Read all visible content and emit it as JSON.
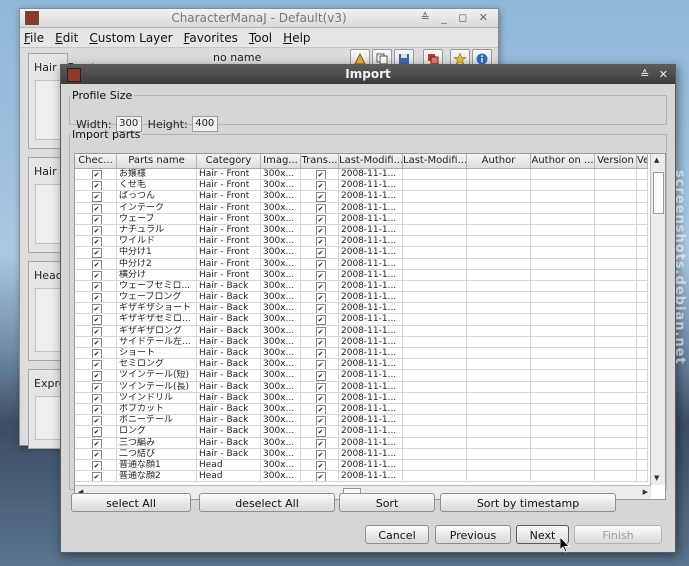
{
  "main_window": {
    "title": "CharacterManaJ - Default(v3)",
    "controls": "≙ _ ◻ ✕",
    "menu": [
      "File",
      "Edit",
      "Custom Layer",
      "Favorites",
      "Tool",
      "Help"
    ],
    "profile_name": "no name",
    "side_panels": [
      "Hair - Front",
      "Hair",
      "Head",
      "Expre"
    ]
  },
  "dialog": {
    "title": "Import",
    "controls": "≙ ✕",
    "profile_size": {
      "legend": "Profile Size",
      "width_label": "Width:",
      "width_value": "300",
      "height_label": "Height:",
      "height_value": "400"
    },
    "import_parts": {
      "legend": "Import parts",
      "columns": [
        "Chec...",
        "Parts name",
        "Category",
        "Imag...",
        "Trans...",
        "Last-Modifi...",
        "Last-Modifi...",
        "Author",
        "Author on ...",
        "Version",
        "Ve"
      ],
      "rows": [
        {
          "name": "お嬢様",
          "category": "Hair - Front",
          "image": "300x...",
          "date": "2008-11-1..."
        },
        {
          "name": "くせ毛",
          "category": "Hair - Front",
          "image": "300x...",
          "date": "2008-11-1..."
        },
        {
          "name": "ぱっつん",
          "category": "Hair - Front",
          "image": "300x...",
          "date": "2008-11-1..."
        },
        {
          "name": "インテーク",
          "category": "Hair - Front",
          "image": "300x...",
          "date": "2008-11-1..."
        },
        {
          "name": "ウェーブ",
          "category": "Hair - Front",
          "image": "300x...",
          "date": "2008-11-1..."
        },
        {
          "name": "ナチュラル",
          "category": "Hair - Front",
          "image": "300x...",
          "date": "2008-11-1..."
        },
        {
          "name": "ワイルド",
          "category": "Hair - Front",
          "image": "300x...",
          "date": "2008-11-1..."
        },
        {
          "name": "中分け1",
          "category": "Hair - Front",
          "image": "300x...",
          "date": "2008-11-1..."
        },
        {
          "name": "中分け2",
          "category": "Hair - Front",
          "image": "300x...",
          "date": "2008-11-1..."
        },
        {
          "name": "横分け",
          "category": "Hair - Front",
          "image": "300x...",
          "date": "2008-11-1..."
        },
        {
          "name": "ウェーブセミロ...",
          "category": "Hair - Back",
          "image": "300x...",
          "date": "2008-11-1..."
        },
        {
          "name": "ウェーブロング",
          "category": "Hair - Back",
          "image": "300x...",
          "date": "2008-11-1..."
        },
        {
          "name": "ギザギザショート",
          "category": "Hair - Back",
          "image": "300x...",
          "date": "2008-11-1..."
        },
        {
          "name": "ギザギザセミロ...",
          "category": "Hair - Back",
          "image": "300x...",
          "date": "2008-11-1..."
        },
        {
          "name": "ギザギザロング",
          "category": "Hair - Back",
          "image": "300x...",
          "date": "2008-11-1..."
        },
        {
          "name": "サイドテール左...",
          "category": "Hair - Back",
          "image": "300x...",
          "date": "2008-11-1..."
        },
        {
          "name": "ショート",
          "category": "Hair - Back",
          "image": "300x...",
          "date": "2008-11-1..."
        },
        {
          "name": "セミロング",
          "category": "Hair - Back",
          "image": "300x...",
          "date": "2008-11-1..."
        },
        {
          "name": "ツインテール(短)",
          "category": "Hair - Back",
          "image": "300x...",
          "date": "2008-11-1..."
        },
        {
          "name": "ツインテール(長)",
          "category": "Hair - Back",
          "image": "300x...",
          "date": "2008-11-1..."
        },
        {
          "name": "ツインドリル",
          "category": "Hair - Back",
          "image": "300x...",
          "date": "2008-11-1..."
        },
        {
          "name": "ボブカット",
          "category": "Hair - Back",
          "image": "300x...",
          "date": "2008-11-1..."
        },
        {
          "name": "ポニーテール",
          "category": "Hair - Back",
          "image": "300x...",
          "date": "2008-11-1..."
        },
        {
          "name": "ロング",
          "category": "Hair - Back",
          "image": "300x...",
          "date": "2008-11-1..."
        },
        {
          "name": "三つ編み",
          "category": "Hair - Back",
          "image": "300x...",
          "date": "2008-11-1..."
        },
        {
          "name": "二つ結び",
          "category": "Hair - Back",
          "image": "300x...",
          "date": "2008-11-1..."
        },
        {
          "name": "普通な顔1",
          "category": "Head",
          "image": "300x...",
          "date": "2008-11-1..."
        },
        {
          "name": "普通な顔2",
          "category": "Head",
          "image": "300x...",
          "date": "2008-11-1..."
        }
      ]
    },
    "actions": {
      "select_all": "select All",
      "deselect_all": "deselect All",
      "sort": "Sort",
      "sort_by_timestamp": "Sort by timestamp"
    },
    "footer": {
      "cancel": "Cancel",
      "previous": "Previous",
      "next": "Next",
      "finish": "Finish"
    }
  },
  "watermark": "screenshots.debian.net"
}
